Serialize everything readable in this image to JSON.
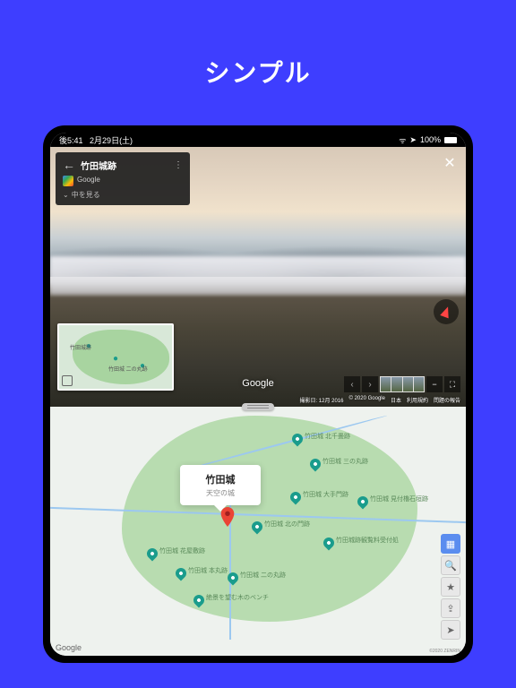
{
  "hero": {
    "title": "シンプル"
  },
  "statusbar": {
    "time": "後5:41",
    "date": "2月29日(土)",
    "battery": "100%"
  },
  "streetview": {
    "panel": {
      "title": "竹田城跡",
      "source": "Google",
      "expand": "中を見る"
    },
    "logo": "Google",
    "attribution": {
      "date": "撮影日: 12月 2016",
      "copyright": "© 2020 Google",
      "country": "日本",
      "terms": "利用規約",
      "report": "問題の報告"
    },
    "minimap": {
      "labels": [
        "竹田城跡",
        "竹田城 二の丸跡"
      ]
    }
  },
  "callout": {
    "title": "竹田城",
    "subtitle": "天空の城"
  },
  "map": {
    "logo": "Google",
    "copyright": "©2020 ZENRIN",
    "pois": [
      "竹田城 北千畳跡",
      "竹田城 三の丸跡",
      "竹田城 大手門跡",
      "竹田城 見付櫓石垣跡",
      "竹田城 北の門跡",
      "竹田城跡観覧料受付処",
      "竹田城 花屋敷跡",
      "竹田城 本丸跡",
      "竹田城 二の丸跡",
      "絶景を望む木のベンチ"
    ]
  }
}
